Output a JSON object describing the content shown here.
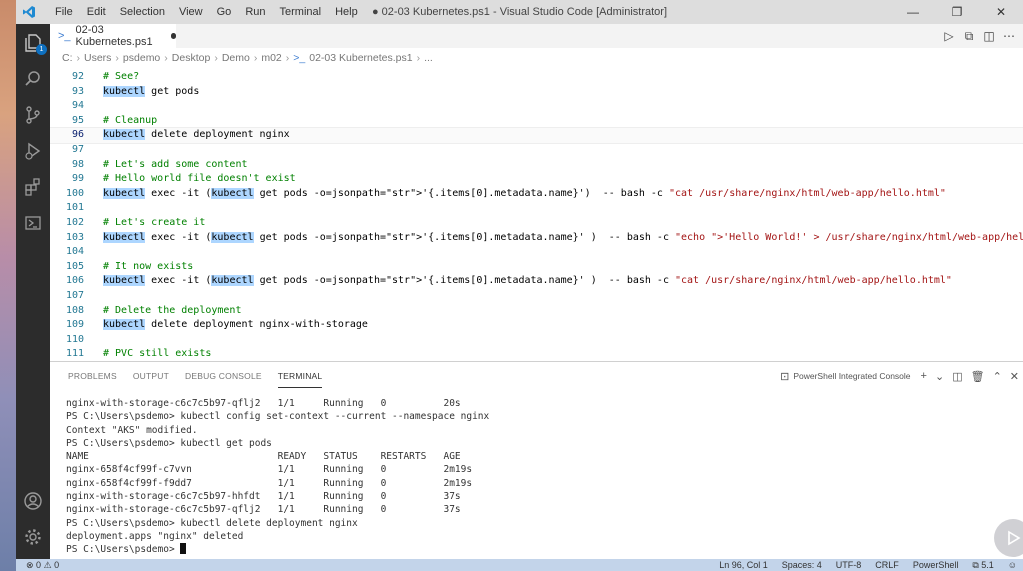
{
  "titlebar": {
    "menu": [
      "File",
      "Edit",
      "Selection",
      "View",
      "Go",
      "Run",
      "Terminal",
      "Help"
    ],
    "title": "● 02-03 Kubernetes.ps1 - Visual Studio Code [Administrator]",
    "controls": [
      "—",
      "❐",
      "✕"
    ]
  },
  "activity": {
    "explorer_badge": "1"
  },
  "tab": {
    "label": "02-03 Kubernetes.ps1"
  },
  "breadcrumb": [
    "C:",
    "Users",
    "psdemo",
    "Desktop",
    "Demo",
    "m02",
    "02-03 Kubernetes.ps1",
    "..."
  ],
  "code": [
    {
      "n": "92",
      "t": "# See?"
    },
    {
      "n": "93",
      "t": "kubectl get pods"
    },
    {
      "n": "94",
      "t": ""
    },
    {
      "n": "95",
      "t": "# Cleanup"
    },
    {
      "n": "96",
      "t": "kubectl delete deployment nginx"
    },
    {
      "n": "97",
      "t": ""
    },
    {
      "n": "98",
      "t": "# Let's add some content"
    },
    {
      "n": "99",
      "t": "# Hello world file doesn't exist"
    },
    {
      "n": "100",
      "t": "kubectl exec -it (kubectl get pods -o=jsonpath='{.items[0].metadata.name}')  -- bash -c \"cat /usr/share/nginx/html/web-app/hello.html\""
    },
    {
      "n": "101",
      "t": ""
    },
    {
      "n": "102",
      "t": "# Let's create it"
    },
    {
      "n": "103",
      "t": "kubectl exec -it (kubectl get pods -o=jsonpath='{.items[0].metadata.name}' )  -- bash -c \"echo 'Hello World!' > /usr/share/nginx/html/web-app/hello.html\""
    },
    {
      "n": "104",
      "t": ""
    },
    {
      "n": "105",
      "t": "# It now exists"
    },
    {
      "n": "106",
      "t": "kubectl exec -it (kubectl get pods -o=jsonpath='{.items[0].metadata.name}' )  -- bash -c \"cat /usr/share/nginx/html/web-app/hello.html\""
    },
    {
      "n": "107",
      "t": ""
    },
    {
      "n": "108",
      "t": "# Delete the deployment"
    },
    {
      "n": "109",
      "t": "kubectl delete deployment nginx-with-storage"
    },
    {
      "n": "110",
      "t": ""
    },
    {
      "n": "111",
      "t": "# PVC still exists"
    }
  ],
  "panel": {
    "tabs": [
      "PROBLEMS",
      "OUTPUT",
      "DEBUG CONSOLE",
      "TERMINAL"
    ],
    "active_tab": "TERMINAL",
    "console_label": "PowerShell Integrated Console"
  },
  "terminal": [
    "nginx-with-storage-c6c7c5b97-qflj2   1/1     Running   0          20s",
    "PS C:\\Users\\psdemo> kubectl config set-context --current --namespace nginx",
    "Context \"AKS\" modified.",
    "PS C:\\Users\\psdemo> kubectl get pods",
    "NAME                                 READY   STATUS    RESTARTS   AGE",
    "nginx-658f4cf99f-c7vvn               1/1     Running   0          2m19s",
    "nginx-658f4cf99f-f9dd7               1/1     Running   0          2m19s",
    "nginx-with-storage-c6c7c5b97-hhfdt   1/1     Running   0          37s",
    "nginx-with-storage-c6c7c5b97-qflj2   1/1     Running   0          37s",
    "PS C:\\Users\\psdemo> kubectl delete deployment nginx",
    "deployment.apps \"nginx\" deleted",
    "PS C:\\Users\\psdemo> "
  ],
  "statusbar": {
    "errors": "0",
    "warnings": "0",
    "position": "Ln 96, Col 1",
    "spaces": "Spaces: 4",
    "encoding": "UTF-8",
    "eol": "CRLF",
    "language": "PowerShell",
    "version": "5.1"
  }
}
